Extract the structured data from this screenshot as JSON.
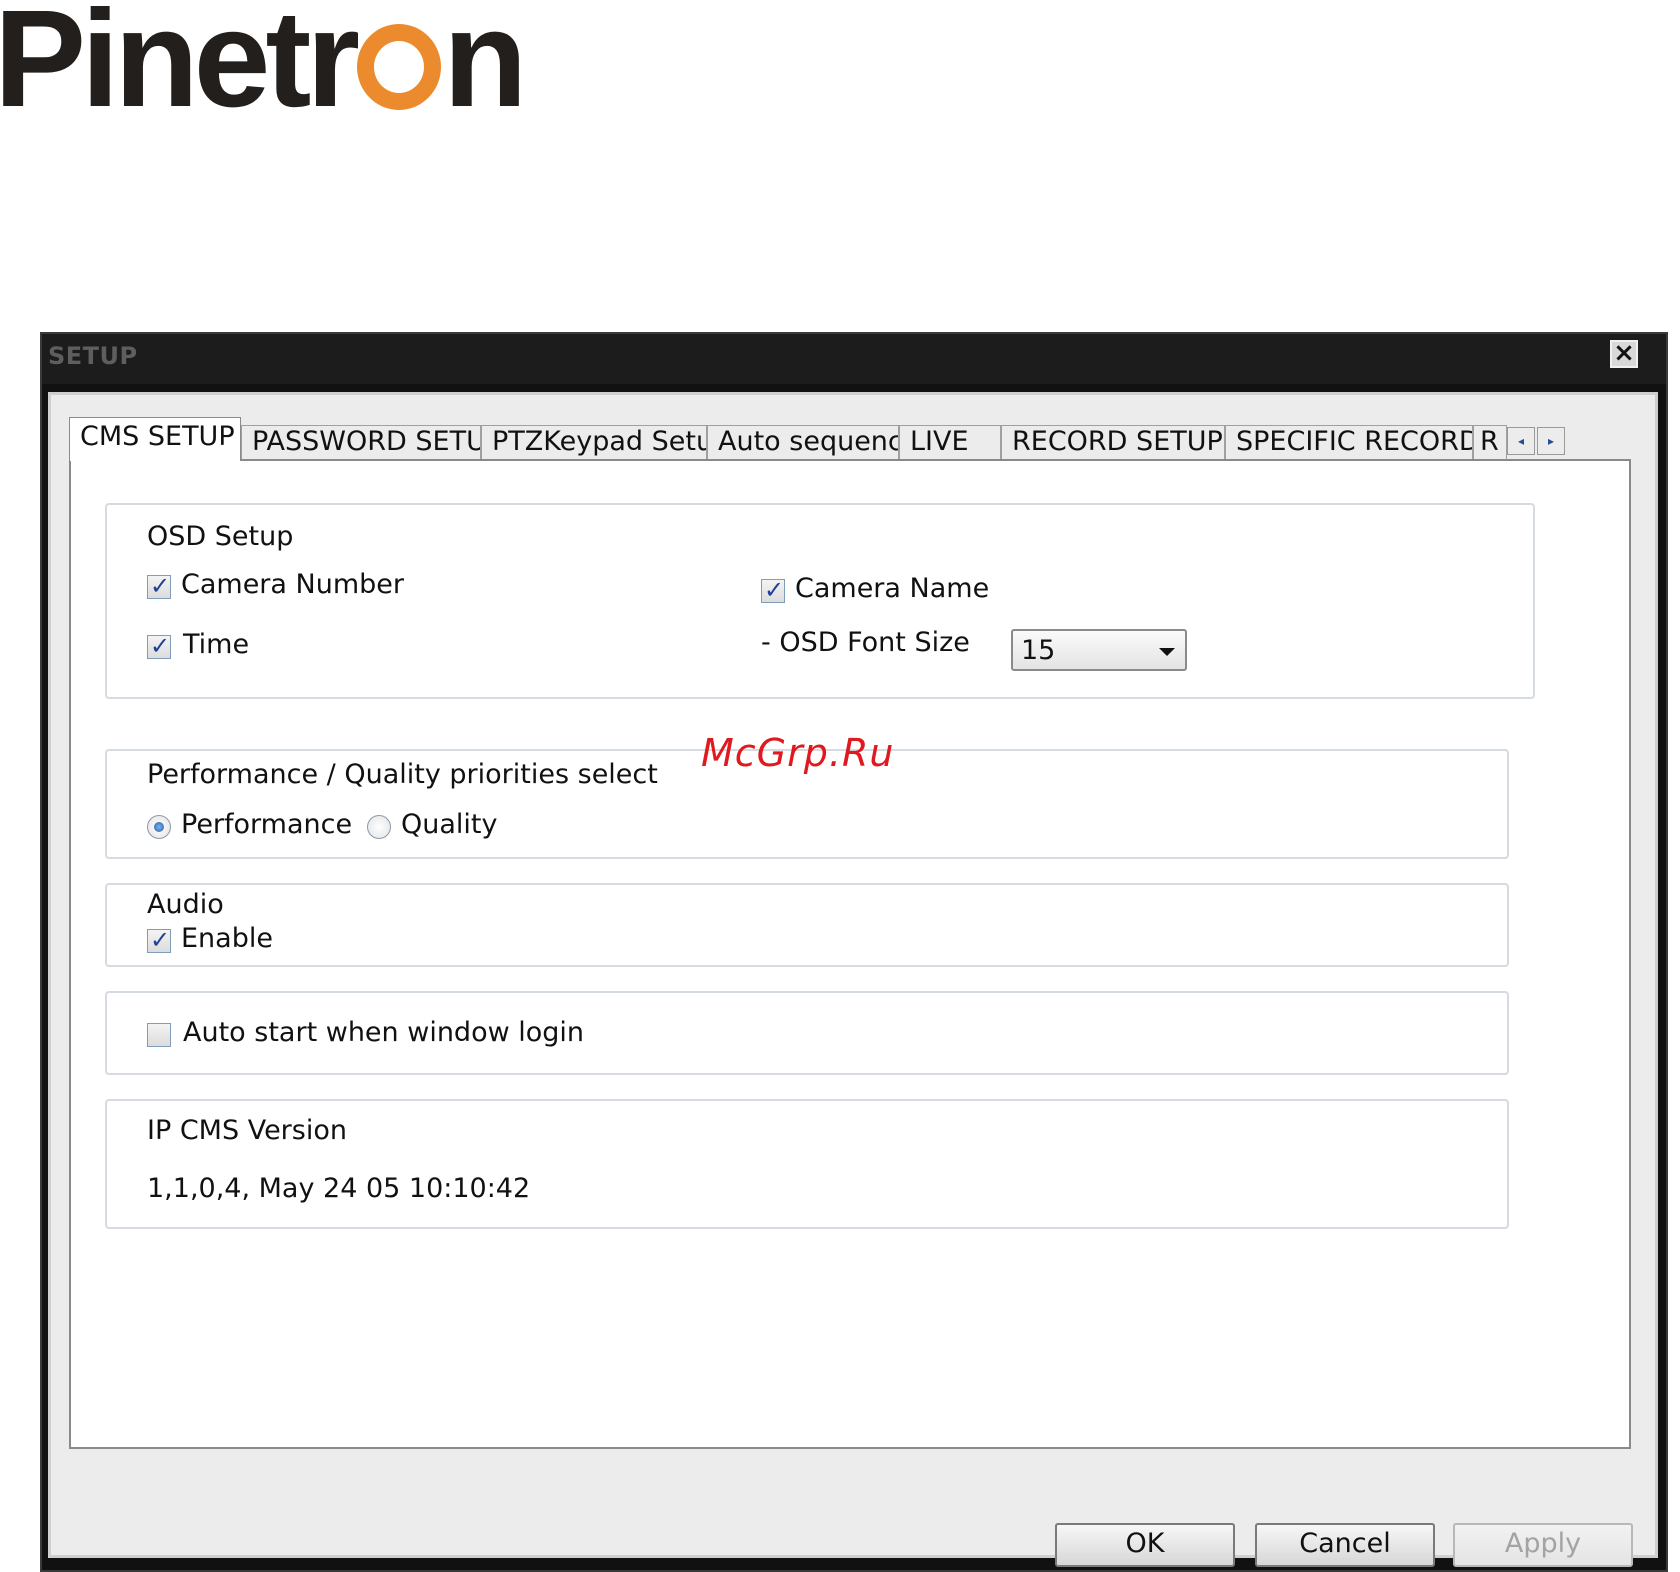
{
  "logo": {
    "text_before": "Pinetr",
    "text_after": "n",
    "brand_colors": {
      "dark": "#231f1c",
      "orange": "#ec8a2e"
    }
  },
  "window": {
    "title": "SETUP",
    "close_icon": "close-icon"
  },
  "tabs": [
    {
      "label": "CMS SETUP",
      "active": true
    },
    {
      "label": "PASSWORD SETUP"
    },
    {
      "label": "PTZKeypad Setup"
    },
    {
      "label": "Auto sequence"
    },
    {
      "label": "LIVE"
    },
    {
      "label": "RECORD SETUP"
    },
    {
      "label": "SPECIFIC RECORD"
    },
    {
      "label": "R"
    }
  ],
  "tab_scroll": {
    "left_icon": "◂",
    "right_icon": "▸"
  },
  "osd": {
    "heading": "OSD Setup",
    "camera_number": {
      "label": "Camera Number",
      "checked": true
    },
    "time": {
      "label": "Time",
      "checked": true
    },
    "camera_name": {
      "label": "Camera Name",
      "checked": true
    },
    "font_size_label": "- OSD Font Size",
    "font_size_value": "15"
  },
  "priority": {
    "heading": "Performance / Quality priorities select",
    "performance": {
      "label": "Performance",
      "selected": true
    },
    "quality": {
      "label": "Quality",
      "selected": false
    }
  },
  "audio": {
    "heading": "Audio",
    "enable": {
      "label": "Enable",
      "checked": true
    }
  },
  "autostart": {
    "label": "Auto start when window login",
    "checked": false
  },
  "version": {
    "heading": "IP CMS Version",
    "value": "1,1,0,4, May 24 05 10:10:42"
  },
  "watermark": "McGrp.Ru",
  "buttons": {
    "ok": "OK",
    "cancel": "Cancel",
    "apply": "Apply"
  }
}
